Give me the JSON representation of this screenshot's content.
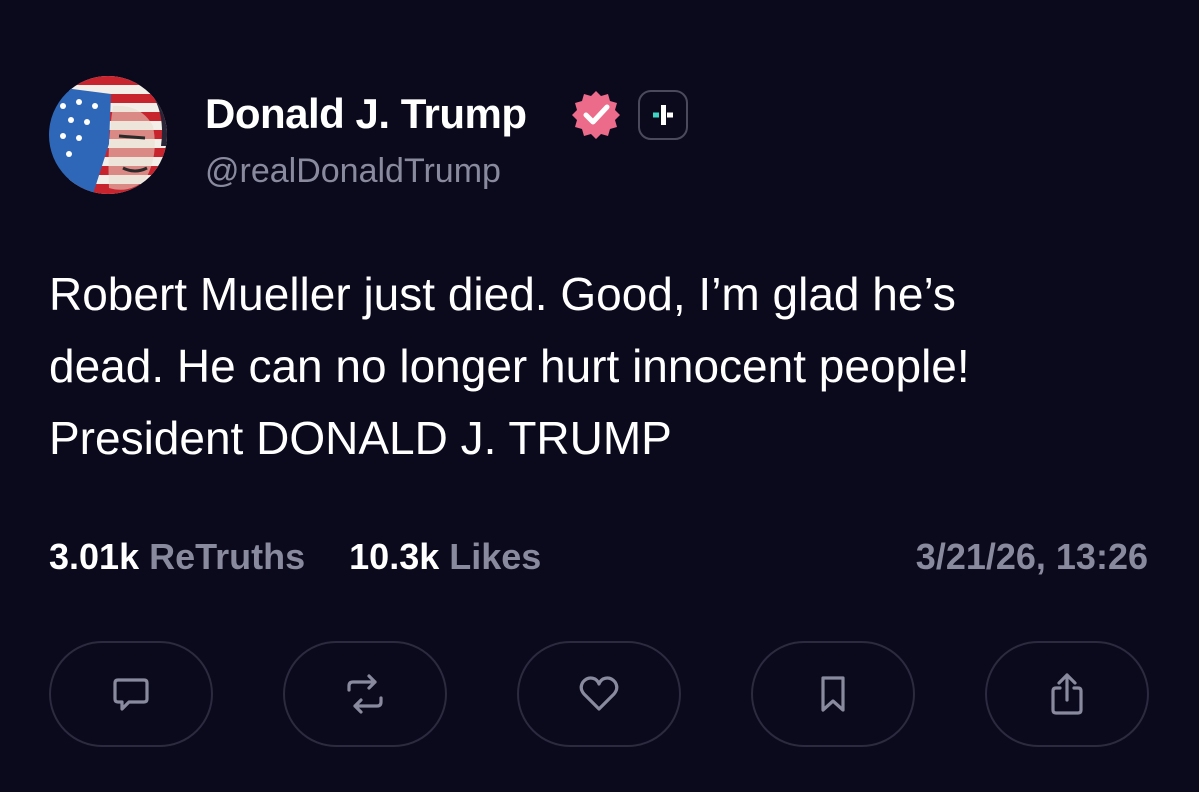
{
  "author": {
    "display_name": "Donald J. Trump",
    "handle": "@realDonaldTrump",
    "verified_icon": "verified-check-icon",
    "badge_icon": "plus-badge-icon",
    "avatar": "avatar-flag-portrait"
  },
  "post": {
    "text_lines": [
      "Robert Mueller just died. Good, I’m glad he’s",
      "dead. He can no longer hurt innocent people!",
      "President DONALD J. TRUMP"
    ]
  },
  "stats": {
    "retruths_count": "3.01k",
    "retruths_label": "ReTruths",
    "likes_count": "10.3k",
    "likes_label": "Likes",
    "timestamp": "3/21/26, 13:26"
  },
  "actions": [
    {
      "name": "reply",
      "icon": "comment-icon"
    },
    {
      "name": "retruth",
      "icon": "repost-icon"
    },
    {
      "name": "like",
      "icon": "heart-icon"
    },
    {
      "name": "bookmark",
      "icon": "bookmark-icon"
    },
    {
      "name": "share",
      "icon": "share-icon"
    }
  ],
  "colors": {
    "background": "#0b0a1c",
    "text": "#ffffff",
    "muted": "#8a8a9e",
    "verified": "#ec6b8a",
    "plus_accent": "#3dd6c4",
    "button_border": "#2b2a3e"
  }
}
